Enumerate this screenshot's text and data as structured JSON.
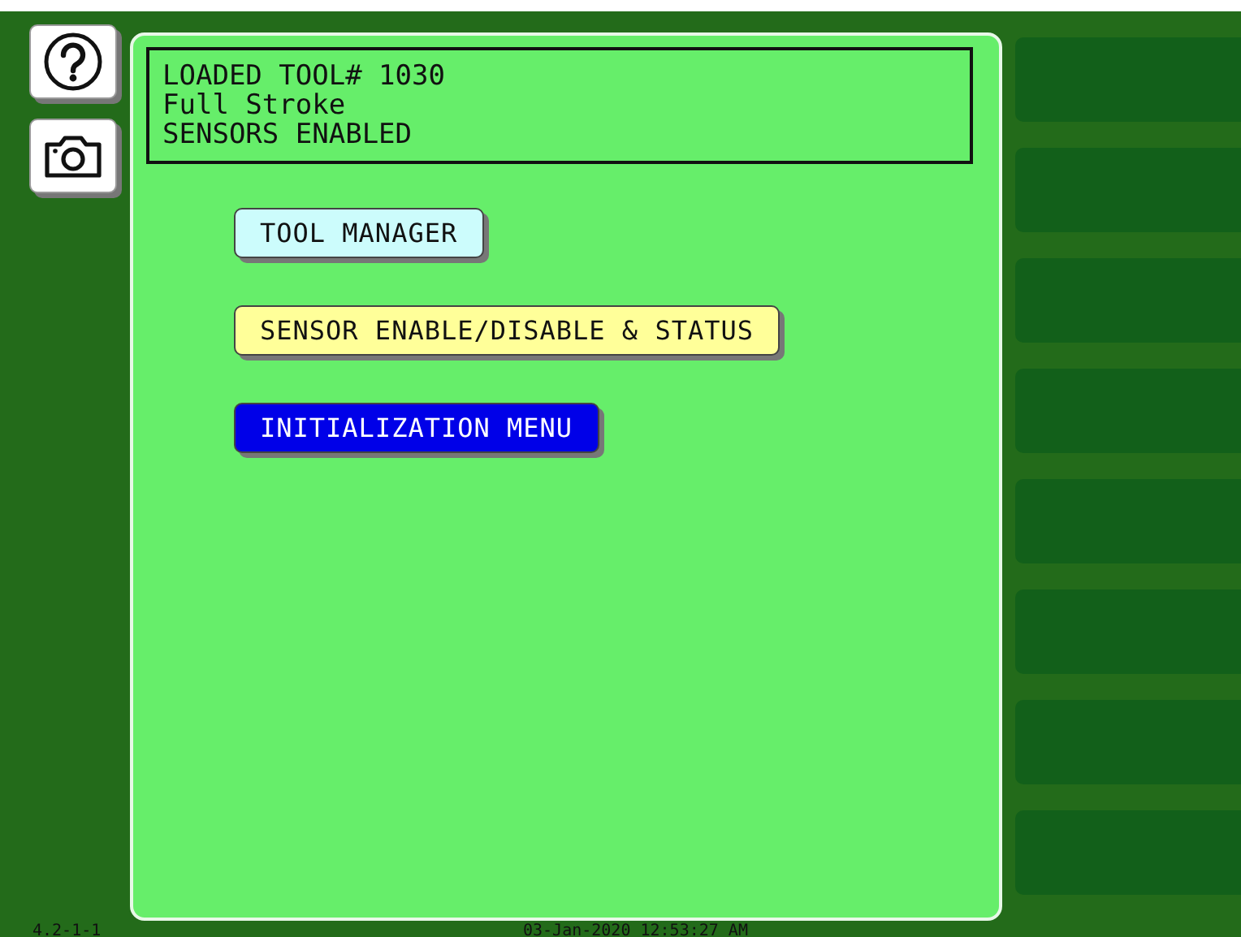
{
  "side_buttons": [
    {
      "kind": "help"
    },
    {
      "kind": "camera"
    }
  ],
  "status_lines": [
    "LOADED TOOL# 1030",
    "Full Stroke",
    "SENSORS ENABLED"
  ],
  "menu_buttons": [
    {
      "label": "TOOL MANAGER",
      "kind": "cyan"
    },
    {
      "label": "SENSOR ENABLE/DISABLE & STATUS",
      "kind": "yellow"
    },
    {
      "label": "INITIALIZATION MENU",
      "kind": "blue"
    }
  ],
  "soft_keys": [
    {
      "kind": "blank"
    },
    {
      "kind": "blank"
    },
    {
      "kind": "blank"
    },
    {
      "kind": "blank"
    },
    {
      "kind": "blank"
    },
    {
      "kind": "blank"
    },
    {
      "kind": "blank"
    },
    {
      "kind": "blank"
    }
  ],
  "footer": {
    "version": "4.2-1-1",
    "datetime": "03-Jan-2020 12:53:27 AM"
  }
}
